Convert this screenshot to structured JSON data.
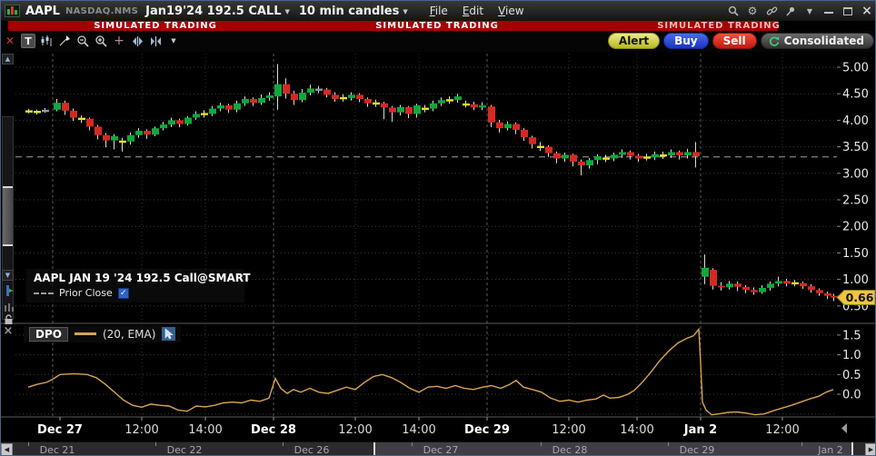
{
  "titlebar": {
    "symbol": "AAPL",
    "exchange": "NASDAQ.NMS",
    "contract": "Jan19'24 192.5 CALL",
    "interval": "10 min candles",
    "menu": [
      {
        "label": "File"
      },
      {
        "label": "Edit"
      },
      {
        "label": "View"
      }
    ]
  },
  "banner": {
    "text": "SIMULATED TRADING"
  },
  "trade_buttons": {
    "alert": "Alert",
    "buy": "Buy",
    "sell": "Sell",
    "consolidated": "Consolidated"
  },
  "legend": {
    "title": "AAPL JAN 19 '24 192.5 Call@SMART",
    "prior_close": "Prior Close",
    "prior_close_checked": true
  },
  "indicator": {
    "name": "DPO",
    "params": "(20, EMA)"
  },
  "last_price": {
    "value": "0.66"
  },
  "colors": {
    "up": "#0fa83c",
    "down": "#d42a22",
    "doji": "#e8e520",
    "neutral": "#9a9a9a",
    "wick": "#dcdcdc",
    "dpo_line": "#d9a351",
    "banner_bg": "#a40000",
    "last_price_tag": "#edc53f",
    "grid": "#3c3c3c",
    "session_line": "#5a5a5a",
    "prior_close_line": "#a0a0a0",
    "axis_text": "#e8e8e8"
  },
  "chart_data": [
    {
      "type": "candlestick",
      "title": "AAPL JAN 19 '24 192.5 Call@SMART",
      "interval": "10 min",
      "ylim": [
        0.19,
        5.26
      ],
      "yticks": [
        5.0,
        4.5,
        4.0,
        3.5,
        3.0,
        2.5,
        2.0,
        1.5,
        1.0,
        0.5
      ],
      "prior_close": 3.31,
      "last": 0.66,
      "session_starts_x": [
        57,
        300,
        535,
        770
      ],
      "minor_ticks_x": [
        155,
        225,
        390,
        460,
        625,
        700,
        860
      ],
      "x_ticks": [
        {
          "x": 65,
          "label": "Dec 27",
          "major": true
        },
        {
          "x": 155,
          "label": "12:00",
          "major": false
        },
        {
          "x": 225,
          "label": "14:00",
          "major": false
        },
        {
          "x": 300,
          "label": "Dec 28",
          "major": true
        },
        {
          "x": 390,
          "label": "12:00",
          "major": false
        },
        {
          "x": 460,
          "label": "14:00",
          "major": false
        },
        {
          "x": 535,
          "label": "Dec 29",
          "major": true
        },
        {
          "x": 625,
          "label": "12:00",
          "major": false
        },
        {
          "x": 700,
          "label": "14:00",
          "major": false
        },
        {
          "x": 770,
          "label": "Jan 2",
          "major": true
        },
        {
          "x": 860,
          "label": "12:00",
          "major": false
        }
      ],
      "candles": [
        [
          30,
          4.17,
          4.21,
          4.13,
          4.17,
          "y"
        ],
        [
          39,
          4.16,
          4.2,
          4.11,
          4.16,
          "y"
        ],
        [
          48,
          4.18,
          4.23,
          4.14,
          4.18,
          "n"
        ],
        [
          61,
          4.2,
          4.4,
          4.17,
          4.33,
          "g"
        ],
        [
          70,
          4.33,
          4.37,
          4.1,
          4.18,
          "r"
        ],
        [
          79,
          4.18,
          4.22,
          3.99,
          4.05,
          "r"
        ],
        [
          88,
          4.03,
          4.09,
          3.95,
          4.03,
          "y"
        ],
        [
          97,
          4.03,
          4.05,
          3.81,
          3.88,
          "r"
        ],
        [
          106,
          3.88,
          3.91,
          3.64,
          3.72,
          "r"
        ],
        [
          115,
          3.72,
          3.76,
          3.49,
          3.62,
          "r"
        ],
        [
          124,
          3.62,
          3.74,
          3.45,
          3.7,
          "g"
        ],
        [
          133,
          3.6,
          3.67,
          3.41,
          3.6,
          "y"
        ],
        [
          142,
          3.6,
          3.77,
          3.54,
          3.72,
          "g"
        ],
        [
          151,
          3.72,
          3.85,
          3.67,
          3.8,
          "g"
        ],
        [
          160,
          3.8,
          3.83,
          3.65,
          3.73,
          "r"
        ],
        [
          169,
          3.73,
          3.88,
          3.7,
          3.85,
          "g"
        ],
        [
          178,
          3.85,
          3.97,
          3.81,
          3.92,
          "g"
        ],
        [
          187,
          3.92,
          4.05,
          3.87,
          4.0,
          "g"
        ],
        [
          196,
          4.0,
          4.03,
          3.87,
          3.93,
          "r"
        ],
        [
          205,
          3.93,
          4.08,
          3.9,
          4.05,
          "g"
        ],
        [
          214,
          4.05,
          4.17,
          4.01,
          4.12,
          "g"
        ],
        [
          223,
          4.12,
          4.19,
          4.05,
          4.12,
          "y"
        ],
        [
          232,
          4.12,
          4.27,
          4.08,
          4.22,
          "g"
        ],
        [
          241,
          4.22,
          4.33,
          4.17,
          4.28,
          "g"
        ],
        [
          250,
          4.28,
          4.31,
          4.14,
          4.2,
          "r"
        ],
        [
          259,
          4.2,
          4.37,
          4.15,
          4.32,
          "g"
        ],
        [
          268,
          4.32,
          4.45,
          4.27,
          4.4,
          "g"
        ],
        [
          277,
          4.4,
          4.43,
          4.27,
          4.33,
          "r"
        ],
        [
          286,
          4.33,
          4.49,
          4.29,
          4.42,
          "g"
        ],
        [
          295,
          4.42,
          4.53,
          4.37,
          4.47,
          "g"
        ],
        [
          304,
          4.45,
          5.06,
          4.2,
          4.68,
          "g"
        ],
        [
          313,
          4.68,
          4.79,
          4.41,
          4.5,
          "r"
        ],
        [
          322,
          4.5,
          4.56,
          4.29,
          4.38,
          "r"
        ],
        [
          331,
          4.38,
          4.59,
          4.34,
          4.52,
          "g"
        ],
        [
          340,
          4.52,
          4.67,
          4.47,
          4.6,
          "g"
        ],
        [
          349,
          4.58,
          4.65,
          4.51,
          4.58,
          "n"
        ],
        [
          358,
          4.58,
          4.61,
          4.43,
          4.48,
          "r"
        ],
        [
          367,
          4.48,
          4.53,
          4.35,
          4.4,
          "r"
        ],
        [
          376,
          4.42,
          4.49,
          4.35,
          4.42,
          "y"
        ],
        [
          385,
          4.42,
          4.53,
          4.37,
          4.48,
          "g"
        ],
        [
          394,
          4.48,
          4.51,
          4.34,
          4.4,
          "r"
        ],
        [
          403,
          4.4,
          4.43,
          4.25,
          4.32,
          "r"
        ],
        [
          412,
          4.32,
          4.39,
          4.25,
          4.32,
          "y"
        ],
        [
          421,
          4.32,
          4.35,
          4.02,
          4.24,
          "r"
        ],
        [
          430,
          4.24,
          4.27,
          3.97,
          4.15,
          "r"
        ],
        [
          439,
          4.15,
          4.29,
          4.09,
          4.25,
          "g"
        ],
        [
          448,
          4.25,
          4.27,
          4.04,
          4.12,
          "r"
        ],
        [
          457,
          4.12,
          4.31,
          4.05,
          4.28,
          "g"
        ],
        [
          466,
          4.22,
          4.29,
          4.15,
          4.22,
          "y"
        ],
        [
          475,
          4.22,
          4.37,
          4.17,
          4.32,
          "g"
        ],
        [
          484,
          4.32,
          4.43,
          4.27,
          4.38,
          "g"
        ],
        [
          493,
          4.38,
          4.45,
          4.31,
          4.38,
          "y"
        ],
        [
          502,
          4.38,
          4.5,
          4.33,
          4.45,
          "g"
        ],
        [
          511,
          4.3,
          4.37,
          4.24,
          4.3,
          "y"
        ],
        [
          520,
          4.3,
          4.35,
          4.19,
          4.24,
          "r"
        ],
        [
          529,
          4.24,
          4.34,
          4.19,
          4.28,
          "g"
        ],
        [
          539,
          4.26,
          4.29,
          3.87,
          3.96,
          "r"
        ],
        [
          548,
          3.96,
          4.01,
          3.77,
          3.85,
          "r"
        ],
        [
          557,
          3.85,
          3.98,
          3.81,
          3.93,
          "g"
        ],
        [
          566,
          3.93,
          3.96,
          3.74,
          3.82,
          "r"
        ],
        [
          575,
          3.82,
          3.85,
          3.61,
          3.68,
          "r"
        ],
        [
          584,
          3.68,
          3.71,
          3.47,
          3.55,
          "r"
        ],
        [
          593,
          3.5,
          3.59,
          3.42,
          3.5,
          "y"
        ],
        [
          602,
          3.5,
          3.53,
          3.31,
          3.38,
          "r"
        ],
        [
          611,
          3.38,
          3.41,
          3.19,
          3.28,
          "r"
        ],
        [
          620,
          3.28,
          3.39,
          3.22,
          3.35,
          "g"
        ],
        [
          629,
          3.35,
          3.37,
          3.13,
          3.22,
          "r"
        ],
        [
          638,
          3.22,
          3.26,
          2.96,
          3.15,
          "r"
        ],
        [
          647,
          3.15,
          3.29,
          3.09,
          3.25,
          "g"
        ],
        [
          656,
          3.25,
          3.36,
          3.17,
          3.32,
          "g"
        ],
        [
          665,
          3.28,
          3.35,
          3.21,
          3.28,
          "y"
        ],
        [
          674,
          3.28,
          3.39,
          3.23,
          3.35,
          "g"
        ],
        [
          683,
          3.35,
          3.45,
          3.29,
          3.4,
          "g"
        ],
        [
          692,
          3.4,
          3.43,
          3.26,
          3.33,
          "r"
        ],
        [
          701,
          3.33,
          3.37,
          3.22,
          3.28,
          "r"
        ],
        [
          710,
          3.3,
          3.37,
          3.24,
          3.3,
          "y"
        ],
        [
          719,
          3.3,
          3.41,
          3.25,
          3.36,
          "g"
        ],
        [
          728,
          3.34,
          3.41,
          3.27,
          3.34,
          "y"
        ],
        [
          737,
          3.34,
          3.45,
          3.29,
          3.4,
          "g"
        ],
        [
          746,
          3.4,
          3.43,
          3.26,
          3.34,
          "r"
        ],
        [
          755,
          3.34,
          3.46,
          3.28,
          3.4,
          "g"
        ],
        [
          764,
          3.4,
          3.59,
          3.11,
          3.32,
          "r"
        ],
        [
          774,
          1.05,
          1.47,
          0.91,
          1.22,
          "g"
        ],
        [
          783,
          1.18,
          1.21,
          0.81,
          0.88,
          "r"
        ],
        [
          792,
          0.88,
          0.95,
          0.79,
          0.85,
          "r"
        ],
        [
          801,
          0.85,
          0.97,
          0.81,
          0.92,
          "g"
        ],
        [
          810,
          0.92,
          0.96,
          0.78,
          0.86,
          "r"
        ],
        [
          819,
          0.86,
          0.89,
          0.74,
          0.8,
          "r"
        ],
        [
          828,
          0.8,
          0.85,
          0.71,
          0.76,
          "r"
        ],
        [
          837,
          0.76,
          0.89,
          0.73,
          0.84,
          "g"
        ],
        [
          846,
          0.84,
          0.96,
          0.79,
          0.92,
          "g"
        ],
        [
          855,
          0.92,
          1.05,
          0.87,
          0.97,
          "g"
        ],
        [
          864,
          0.97,
          1.01,
          0.87,
          0.92,
          "r"
        ],
        [
          873,
          0.93,
          0.99,
          0.87,
          0.93,
          "y"
        ],
        [
          882,
          0.93,
          0.96,
          0.82,
          0.87,
          "r"
        ],
        [
          891,
          0.87,
          0.91,
          0.75,
          0.8,
          "r"
        ],
        [
          900,
          0.8,
          0.83,
          0.69,
          0.74,
          "r"
        ],
        [
          909,
          0.74,
          0.77,
          0.63,
          0.69,
          "r"
        ],
        [
          916,
          0.69,
          0.73,
          0.59,
          0.66,
          "r"
        ]
      ]
    },
    {
      "type": "line",
      "name": "DPO (20, EMA)",
      "ylim": [
        -0.55,
        1.77
      ],
      "yticks": [
        1.5,
        1.0,
        0.5,
        0.0
      ],
      "extra_gridlines": [
        -0.5
      ],
      "points": [
        [
          30,
          0.18
        ],
        [
          40,
          0.25
        ],
        [
          50,
          0.3
        ],
        [
          57,
          0.38
        ],
        [
          65,
          0.5
        ],
        [
          80,
          0.52
        ],
        [
          95,
          0.5
        ],
        [
          105,
          0.42
        ],
        [
          115,
          0.25
        ],
        [
          125,
          0.05
        ],
        [
          135,
          -0.15
        ],
        [
          145,
          -0.28
        ],
        [
          155,
          -0.33
        ],
        [
          165,
          -0.25
        ],
        [
          175,
          -0.28
        ],
        [
          185,
          -0.3
        ],
        [
          195,
          -0.4
        ],
        [
          205,
          -0.43
        ],
        [
          215,
          -0.3
        ],
        [
          225,
          -0.32
        ],
        [
          235,
          -0.28
        ],
        [
          245,
          -0.22
        ],
        [
          255,
          -0.2
        ],
        [
          265,
          -0.22
        ],
        [
          275,
          -0.15
        ],
        [
          285,
          -0.18
        ],
        [
          295,
          -0.1
        ],
        [
          302,
          0.4
        ],
        [
          308,
          0.15
        ],
        [
          315,
          0.02
        ],
        [
          322,
          0.12
        ],
        [
          330,
          0.05
        ],
        [
          340,
          0.15
        ],
        [
          350,
          0.05
        ],
        [
          360,
          0.02
        ],
        [
          370,
          0.1
        ],
        [
          380,
          0.18
        ],
        [
          390,
          0.12
        ],
        [
          400,
          0.3
        ],
        [
          410,
          0.45
        ],
        [
          420,
          0.5
        ],
        [
          430,
          0.42
        ],
        [
          440,
          0.3
        ],
        [
          450,
          0.15
        ],
        [
          460,
          0.05
        ],
        [
          470,
          0.18
        ],
        [
          480,
          0.2
        ],
        [
          490,
          0.15
        ],
        [
          500,
          0.22
        ],
        [
          510,
          0.15
        ],
        [
          520,
          0.12
        ],
        [
          530,
          0.18
        ],
        [
          540,
          0.22
        ],
        [
          550,
          0.15
        ],
        [
          560,
          0.25
        ],
        [
          567,
          0.35
        ],
        [
          575,
          0.18
        ],
        [
          585,
          0.12
        ],
        [
          595,
          0.05
        ],
        [
          605,
          -0.1
        ],
        [
          615,
          -0.18
        ],
        [
          625,
          -0.15
        ],
        [
          635,
          -0.2
        ],
        [
          645,
          -0.15
        ],
        [
          655,
          -0.12
        ],
        [
          663,
          -0.02
        ],
        [
          670,
          -0.1
        ],
        [
          680,
          -0.08
        ],
        [
          690,
          0.0
        ],
        [
          697,
          0.1
        ],
        [
          705,
          0.28
        ],
        [
          715,
          0.55
        ],
        [
          725,
          0.85
        ],
        [
          735,
          1.1
        ],
        [
          745,
          1.3
        ],
        [
          755,
          1.42
        ],
        [
          762,
          1.48
        ],
        [
          768,
          1.65
        ],
        [
          770,
          0.8
        ],
        [
          772,
          -0.2
        ],
        [
          776,
          -0.4
        ],
        [
          782,
          -0.52
        ],
        [
          790,
          -0.5
        ],
        [
          800,
          -0.46
        ],
        [
          810,
          -0.45
        ],
        [
          820,
          -0.48
        ],
        [
          830,
          -0.52
        ],
        [
          840,
          -0.5
        ],
        [
          850,
          -0.42
        ],
        [
          860,
          -0.35
        ],
        [
          870,
          -0.28
        ],
        [
          880,
          -0.2
        ],
        [
          890,
          -0.12
        ],
        [
          900,
          -0.05
        ],
        [
          908,
          0.05
        ],
        [
          916,
          0.12
        ]
      ]
    }
  ],
  "timeline": {
    "labels": [
      {
        "x": 30,
        "label": "Dec 21"
      },
      {
        "x": 170,
        "label": "Dec 22"
      },
      {
        "x": 310,
        "label": "Dec 26"
      },
      {
        "x": 452,
        "label": "Dec 27"
      },
      {
        "x": 594,
        "label": "Dec 28"
      },
      {
        "x": 734,
        "label": "Dec 29"
      },
      {
        "x": 881,
        "label": "Jan 2"
      }
    ]
  }
}
